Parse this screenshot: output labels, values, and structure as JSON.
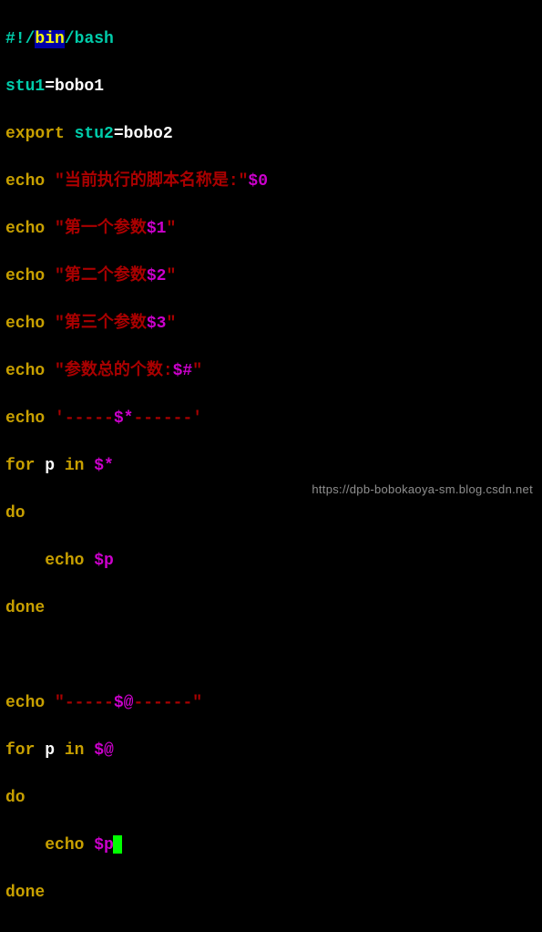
{
  "shebang": {
    "hash": "#!",
    "slash1": "/",
    "bin": "bin",
    "slash2": "/",
    "bash": "bash"
  },
  "l2": {
    "var": "stu1",
    "eq": "=",
    "val": "bobo1"
  },
  "l3": {
    "kw": "export ",
    "var": "stu2",
    "eq": "=",
    "val": "bobo2"
  },
  "l4": {
    "echo": "echo ",
    "s1": "\"当前执行的脚本名称是:\"",
    "p": "$0"
  },
  "l5": {
    "echo": "echo ",
    "s1": "\"第一个参数",
    "p": "$1",
    "s2": "\""
  },
  "l6": {
    "echo": "echo ",
    "s1": "\"第二个参数",
    "p": "$2",
    "s2": "\""
  },
  "l7": {
    "echo": "echo ",
    "s1": "\"第三个参数",
    "p": "$3",
    "s2": "\""
  },
  "l8": {
    "echo": "echo ",
    "s1": "\"参数总的个数:",
    "p": "$#",
    "s2": "\""
  },
  "l9": {
    "echo": "echo ",
    "s1": "'-----",
    "p": "$*",
    "s2": "------'"
  },
  "l10": {
    "for": "for ",
    "v": "p",
    "in": " in ",
    "p": "$*"
  },
  "l11": {
    "do": "do"
  },
  "l12": {
    "indent": "    ",
    "echo": "echo ",
    "p": "$p"
  },
  "l13": {
    "done": "done"
  },
  "l15": {
    "echo": "echo ",
    "s1": "\"-----",
    "p": "$@",
    "s2": "------\""
  },
  "l16": {
    "for": "for ",
    "v": "p",
    "in": " in ",
    "p": "$@"
  },
  "l17": {
    "do": "do"
  },
  "l18": {
    "indent": "    ",
    "echo": "echo ",
    "p": "$p"
  },
  "l19": {
    "done": "done"
  },
  "watermark": "https://dpb-bobokaoya-sm.blog.csdn.net"
}
